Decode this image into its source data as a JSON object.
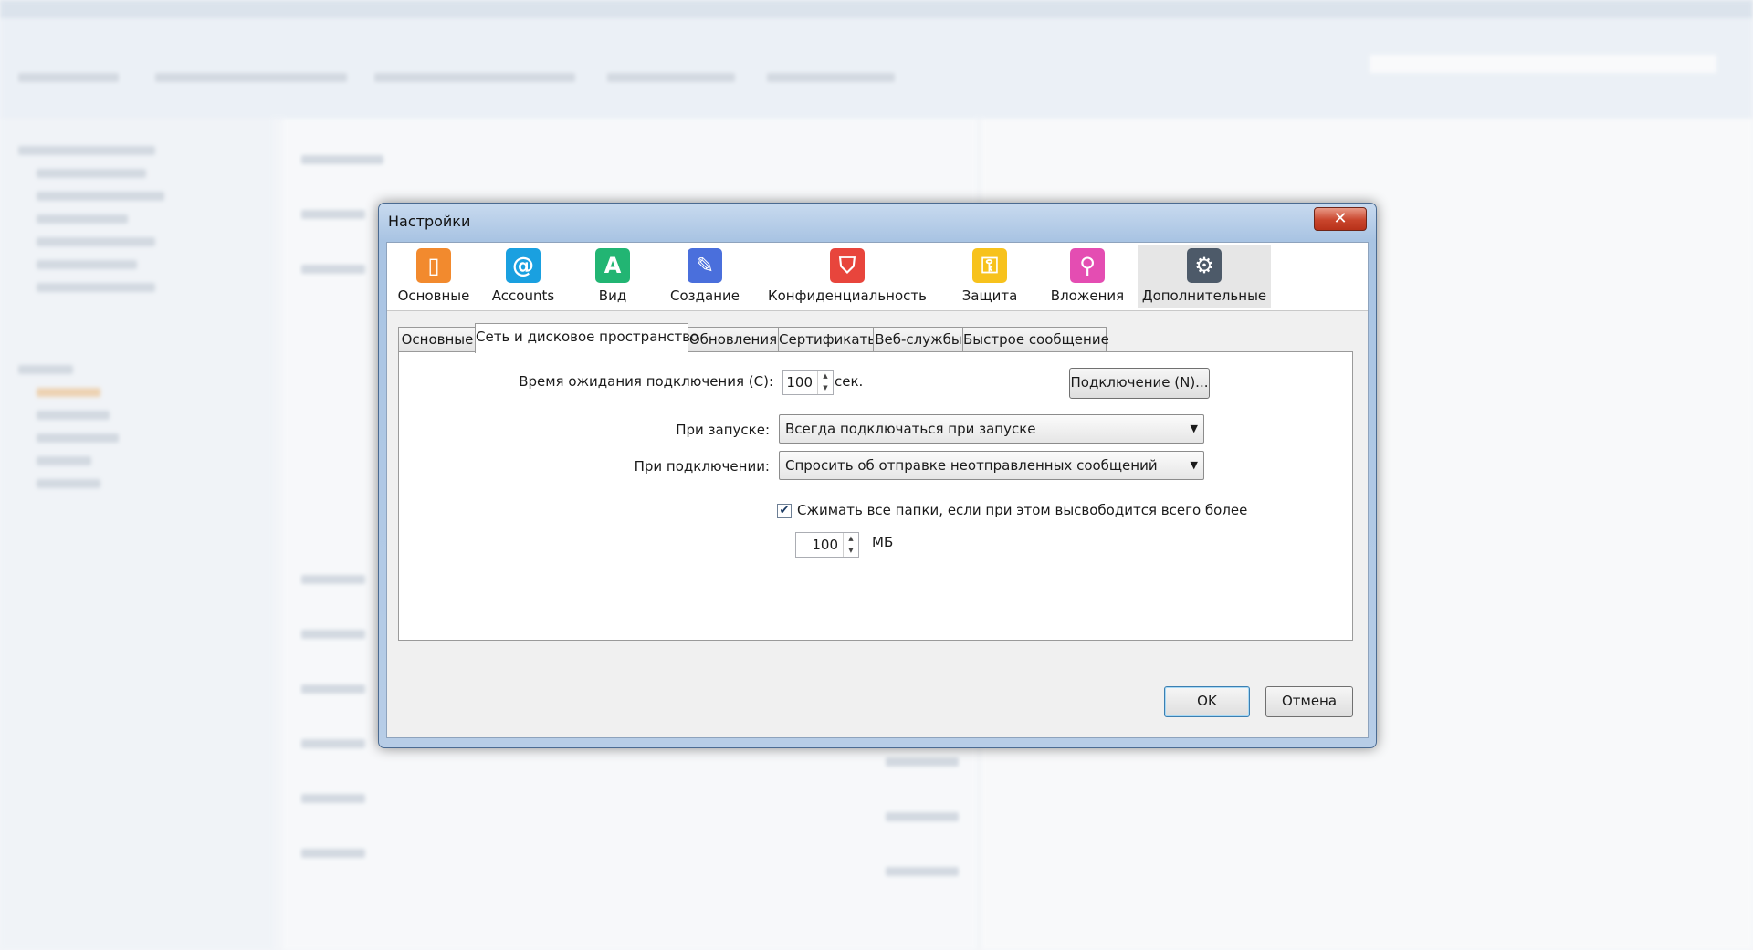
{
  "dialog": {
    "title": "Настройки",
    "close_label": "✕",
    "categories": [
      {
        "label": "Основные",
        "icon": "phone-icon",
        "color": "#f28a2e"
      },
      {
        "label": "Accounts",
        "icon": "at-sign-icon",
        "color": "#1aa0e0"
      },
      {
        "label": "Вид",
        "icon": "font-a-icon",
        "color": "#22b573"
      },
      {
        "label": "Создание",
        "icon": "pencil-icon",
        "color": "#4a6fdc"
      },
      {
        "label": "Конфиденциальность",
        "icon": "shield-icon",
        "color": "#e8453c"
      },
      {
        "label": "Защита",
        "icon": "lock-icon",
        "color": "#f7c21c"
      },
      {
        "label": "Вложения",
        "icon": "paperclip-icon",
        "color": "#e44db2"
      },
      {
        "label": "Дополнительные",
        "icon": "gear-icon",
        "color": "#4d5a69"
      }
    ],
    "active_category": "Дополнительные",
    "tabs": [
      "Основные",
      "Сеть и дисковое пространство",
      "Обновления",
      "Сертификаты",
      "Веб-службы",
      "Быстрое сообщение"
    ],
    "active_tab": "Сеть и дисковое пространство",
    "timeout_label": "Время ожидания подключения (С):",
    "timeout_value": "100",
    "timeout_unit": "сек.",
    "connection_button": "Подключение (N)...",
    "startup_label": "При запуске:",
    "startup_value": "Всегда подключаться при запуске",
    "on_connect_label": "При подключении:",
    "on_connect_value": "Спросить об отправке неотправленных сообщений",
    "compress_checked": true,
    "compress_label": "Сжимать все папки, если при этом высвободится всего более",
    "compress_value": "100",
    "compress_unit": "МБ",
    "ok_label": "OK",
    "cancel_label": "Отмена"
  }
}
